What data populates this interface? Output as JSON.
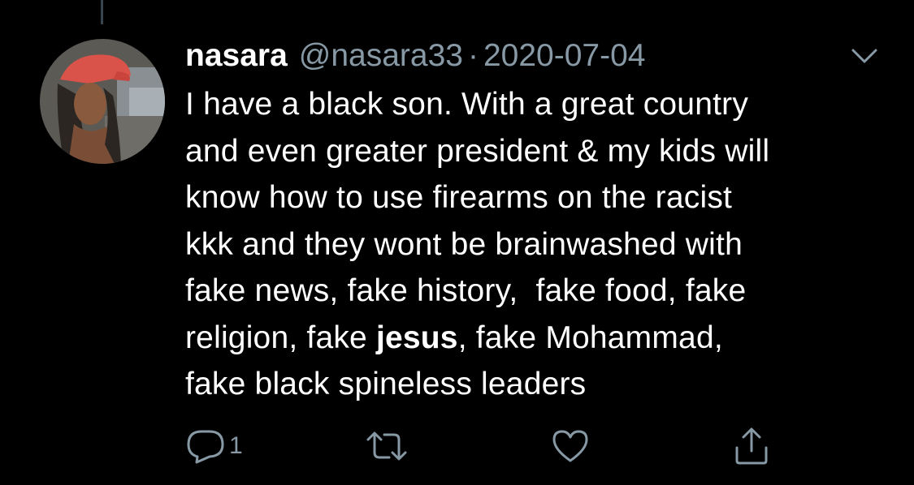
{
  "tweet": {
    "display_name": "nasara",
    "handle": "@nasara33",
    "separator": "·",
    "date": "2020-07-04",
    "text_lines": [
      [
        "I have a black son. With a great country"
      ],
      [
        "and even greater president & my kids will"
      ],
      [
        "know how to use firearms on the racist"
      ],
      [
        "kkk and they wont be brainwashed with"
      ],
      [
        "fake news, fake history,  fake food, fake"
      ],
      [
        "religion, fake ",
        "jesus",
        ", fake Mohammad,"
      ],
      [
        "fake black spineless leaders"
      ]
    ],
    "reply_count": "1"
  },
  "icons": {
    "avatar": "profile-photo",
    "menu": "chevron-down-icon",
    "reply": "reply-icon",
    "retweet": "retweet-icon",
    "like": "heart-icon",
    "share": "share-icon"
  },
  "colors": {
    "background": "#000000",
    "text": "#ffffff",
    "muted": "#8899a6"
  }
}
